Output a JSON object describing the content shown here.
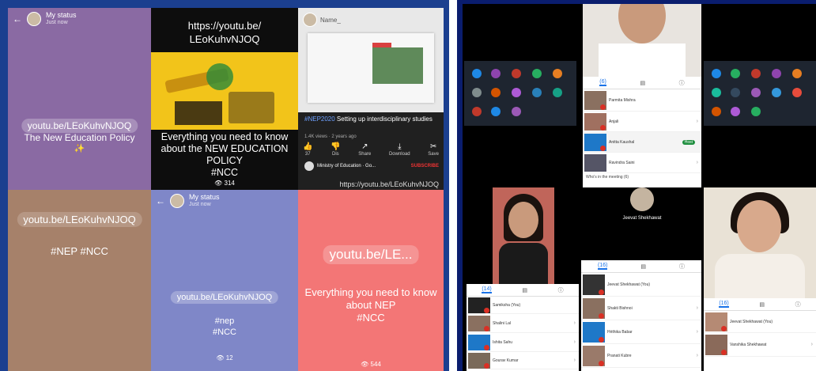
{
  "left_collage": {
    "cell1": {
      "status_title": "My status",
      "status_sub": "Just now",
      "link": "youtu.be/LEoKuhvNJOQ",
      "line1": "The New Education Policy",
      "sparkle": "✨"
    },
    "cell2": {
      "url_line1": "https://youtu.be/",
      "url_line2": "LEoKuhvNJOQ",
      "headline_l1": "Everything you need to know",
      "headline_l2": "about the NEW EDUCATION",
      "headline_l3": "POLICY",
      "tag": "#NCC",
      "views": "314"
    },
    "cell3": {
      "header_name": "Name_",
      "video_tag": "#NEP2020",
      "video_title": " Setting up interdisciplinary studies",
      "video_meta": "1.4K views · 2 years ago",
      "actions": [
        {
          "icon": "👍",
          "label": "37"
        },
        {
          "icon": "👎",
          "label": "Dis"
        },
        {
          "icon": "↗",
          "label": "Share"
        },
        {
          "icon": "⤓",
          "label": "Download"
        },
        {
          "icon": "✂",
          "label": "Save"
        }
      ],
      "channel": "Ministry of Education · Go...",
      "subscribe": "SUBSCRIBE",
      "link_caption": "https://youtu.be/LEoKuhvNJOQ"
    },
    "cell4": {
      "link": "youtu.be/LEoKuhvNJOQ",
      "tags": "#NEP #NCC"
    },
    "cell5": {
      "status_title": "My status",
      "status_sub": "Just now",
      "link": "youtu.be/LEoKuhvNJOQ",
      "tag1": "#nep",
      "tag2": "#NCC",
      "views": "12"
    },
    "cell6": {
      "link": "youtu.be/LE...",
      "headline_l1": "Everything you need to know",
      "headline_l2": "about NEP",
      "tag": "#NCC",
      "views": "544"
    }
  },
  "meet": {
    "panel_top": {
      "tabs": [
        "(6)",
        "▤",
        "ⓘ"
      ],
      "rows": [
        {
          "name": "Parmita Mishra"
        },
        {
          "name": "Anjali"
        },
        {
          "name": "Anitta Kaushal",
          "badge": "Host"
        },
        {
          "name": "Ravindra Saini"
        }
      ],
      "footer": "Who's in the meeting (6)"
    },
    "center_name": "Jeevat Shekhawat",
    "panel_mid": {
      "tabs": [
        "(16)",
        "▤",
        "ⓘ"
      ],
      "rows": [
        {
          "name": "Jeevat Shekhawat (You)"
        },
        {
          "name": "Shakti Bishnoi"
        },
        {
          "name": "Hrithika Babar"
        },
        {
          "name": "Pranati Kubre"
        }
      ]
    },
    "panel_left": {
      "tabs": [
        "(14)",
        "▤",
        "ⓘ"
      ],
      "rows": [
        {
          "name": "Samiksha (You)"
        },
        {
          "name": "Shalini Lal"
        },
        {
          "name": "Ishita Sahu"
        },
        {
          "name": "Gourav Kumar"
        }
      ]
    },
    "panel_right": {
      "tabs": [
        "(16)",
        "▤",
        "ⓘ"
      ],
      "rows": [
        {
          "name": "Jeevat Shekhawat (You)"
        },
        {
          "name": "Vanshika Shekhawat"
        }
      ]
    }
  }
}
